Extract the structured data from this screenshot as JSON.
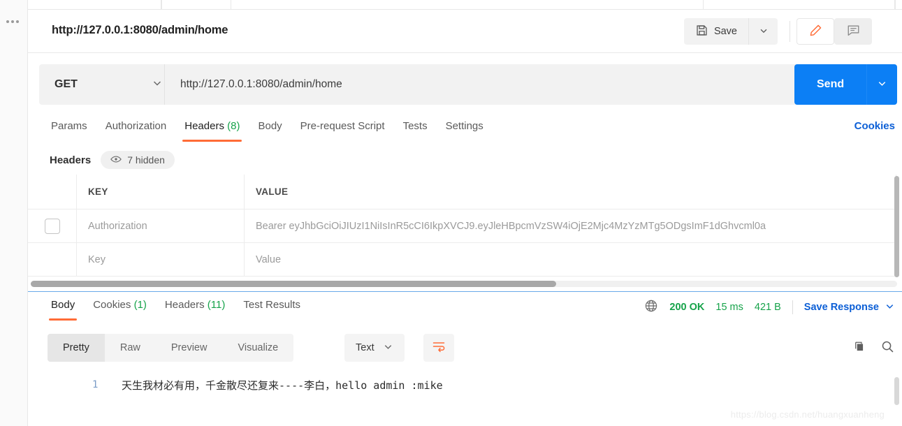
{
  "window": {
    "request_title": "http://127.0.0.1:8080/admin/home"
  },
  "toolbar": {
    "save_label": "Save",
    "save_icon": "floppy-disk-icon",
    "save_caret_icon": "chevron-down-icon",
    "edit_icon": "pencil-icon",
    "comment_icon": "comment-icon",
    "accent_color": "#ff6c37"
  },
  "url_bar": {
    "method": "GET",
    "method_caret_icon": "chevron-down-icon",
    "url": "http://127.0.0.1:8080/admin/home",
    "send_label": "Send",
    "send_caret_icon": "chevron-down-icon",
    "send_color": "#0c7ff5"
  },
  "request_tabs": {
    "items": [
      {
        "label": "Params",
        "count": "",
        "active": false
      },
      {
        "label": "Authorization",
        "count": "",
        "active": false
      },
      {
        "label": "Headers",
        "count": "(8)",
        "active": true
      },
      {
        "label": "Body",
        "count": "",
        "active": false
      },
      {
        "label": "Pre-request Script",
        "count": "",
        "active": false
      },
      {
        "label": "Tests",
        "count": "",
        "active": false
      },
      {
        "label": "Settings",
        "count": "",
        "active": false
      }
    ],
    "cookies_link": "Cookies"
  },
  "headers_section": {
    "label": "Headers",
    "hidden_pill": "7 hidden",
    "eye_icon": "eye-icon",
    "columns": [
      "KEY",
      "VALUE"
    ],
    "rows": [
      {
        "checked": false,
        "key": "Authorization",
        "value": "Bearer eyJhbGciOiJIUzI1NiIsInR5cCI6IkpXVCJ9.eyJleHBpcmVzSW4iOjE2Mjc4MzYzMTg5ODgsImF1dGhvcml0a"
      },
      {
        "checked": false,
        "key": "Key",
        "value": "Value"
      }
    ]
  },
  "response": {
    "tabs": [
      {
        "label": "Body",
        "count": "",
        "active": true
      },
      {
        "label": "Cookies",
        "count": "(1)",
        "active": false
      },
      {
        "label": "Headers",
        "count": "(11)",
        "active": false
      },
      {
        "label": "Test Results",
        "count": "",
        "active": false
      }
    ],
    "globe_icon": "globe-icon",
    "status": "200 OK",
    "time": "15 ms",
    "size": "421 B",
    "save_response_label": "Save Response",
    "save_response_caret_icon": "chevron-down-icon",
    "views": [
      {
        "label": "Pretty",
        "active": true
      },
      {
        "label": "Raw",
        "active": false
      },
      {
        "label": "Preview",
        "active": false
      },
      {
        "label": "Visualize",
        "active": false
      }
    ],
    "format": "Text",
    "format_caret_icon": "chevron-down-icon",
    "wrap_icon": "word-wrap-icon",
    "copy_icon": "copy-icon",
    "search_icon": "search-icon",
    "line_number": "1",
    "body_text": "天生我材必有用，千金散尽还复来----李白，hello admin :mike"
  },
  "watermark": "https://blog.csdn.net/huangxuanheng"
}
